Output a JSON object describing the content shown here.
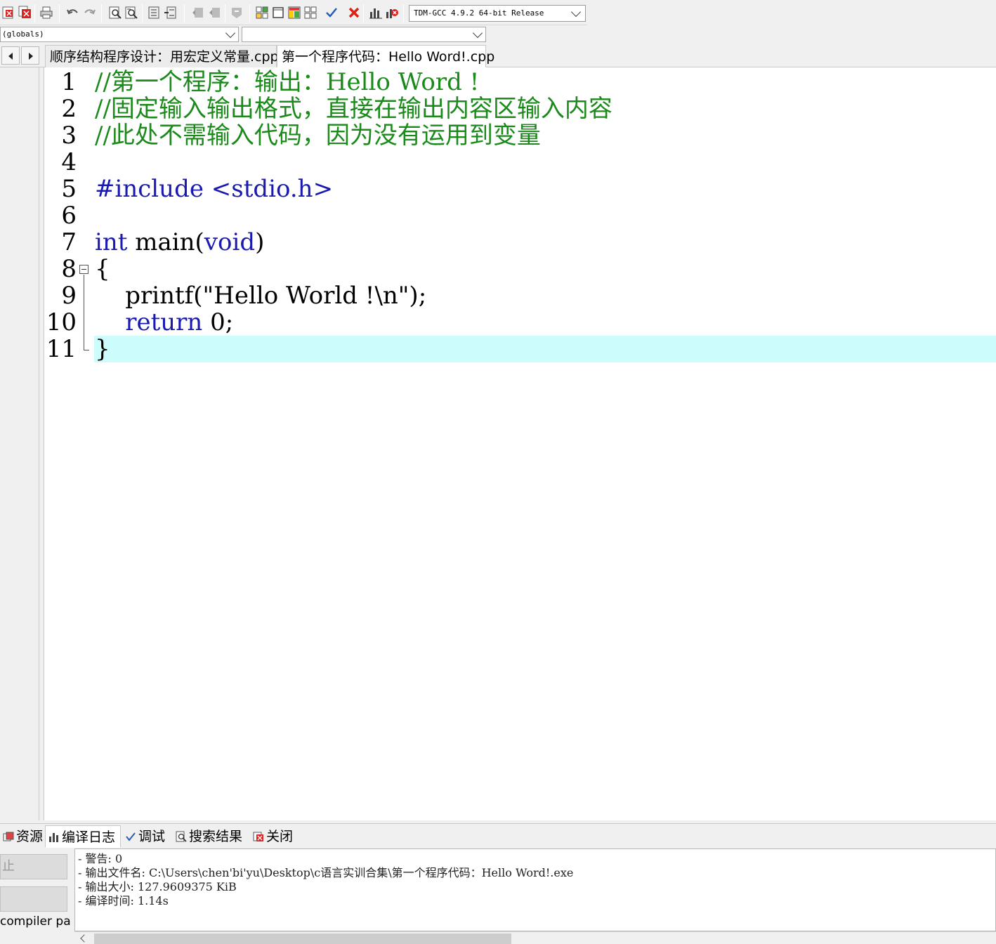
{
  "toolbar": {
    "buttons": [
      "close-file-icon",
      "close-all-icon",
      "print-icon",
      "undo-icon",
      "redo-icon",
      "find-icon",
      "replace-icon",
      "indent-icon",
      "unindent-icon",
      "goto-prev-icon",
      "goto-next-icon",
      "bookmark-icon",
      "new-project-icon",
      "view-window-icon",
      "compile-icon",
      "run-icon",
      "check-syntax-icon",
      "stop-icon",
      "chart-icon",
      "profile-icon"
    ],
    "compiler": "TDM-GCC 4.9.2 64-bit Release"
  },
  "classbar": {
    "scope": "(globals)",
    "member": ""
  },
  "tabs": [
    {
      "label": "顺序结构程序设计：用宏定义常量.cpp",
      "active": false
    },
    {
      "label": "第一个程序代码：Hello Word!.cpp",
      "active": true
    }
  ],
  "editor": {
    "lines": [
      {
        "num": "1",
        "tokens": [
          {
            "t": "//第一个程序：输出：Hello Word !",
            "c": "comment"
          }
        ]
      },
      {
        "num": "2",
        "tokens": [
          {
            "t": "//固定输入输出格式，直接在输出内容区输入内容",
            "c": "comment"
          }
        ]
      },
      {
        "num": "3",
        "tokens": [
          {
            "t": "//此处不需输入代码，因为没有运用到变量",
            "c": "comment"
          }
        ]
      },
      {
        "num": "4",
        "tokens": []
      },
      {
        "num": "5",
        "tokens": [
          {
            "t": "#include <stdio.h>",
            "c": "pre"
          }
        ]
      },
      {
        "num": "6",
        "tokens": []
      },
      {
        "num": "7",
        "tokens": [
          {
            "t": "int",
            "c": "kw"
          },
          {
            "t": " main(",
            "c": "plain"
          },
          {
            "t": "void",
            "c": "kw"
          },
          {
            "t": ")",
            "c": "plain"
          }
        ]
      },
      {
        "num": "8",
        "tokens": [
          {
            "t": "{",
            "c": "plain"
          }
        ]
      },
      {
        "num": "9",
        "tokens": [
          {
            "t": "    printf(\"Hello World !\\n\");",
            "c": "plain"
          }
        ]
      },
      {
        "num": "10",
        "tokens": [
          {
            "t": "    ",
            "c": "plain"
          },
          {
            "t": "return",
            "c": "kw"
          },
          {
            "t": " 0;",
            "c": "plain"
          }
        ]
      },
      {
        "num": "11",
        "tokens": [
          {
            "t": "}",
            "c": "plain"
          }
        ]
      }
    ],
    "current_line": 11,
    "colors": {
      "comment": "#1a8a1a",
      "keyword": "#1a1ab0",
      "current_line_bg": "#ccfcfc"
    }
  },
  "bottom": {
    "tabs": [
      {
        "label": "资源",
        "icon": "resource-icon"
      },
      {
        "label": "编译日志",
        "icon": "compile-log-icon",
        "active": true
      },
      {
        "label": "调试",
        "icon": "debug-icon"
      },
      {
        "label": "搜索结果",
        "icon": "search-results-icon"
      },
      {
        "label": "关闭",
        "icon": "close-panel-icon"
      }
    ],
    "stop_button": "止",
    "compiler_path_label": "compiler pat",
    "log_lines": [
      "- 警告: 0",
      "- 输出文件名: C:\\Users\\chen'bi'yu\\Desktop\\c语言实训合集\\第一个程序代码：Hello Word!.exe",
      "- 输出大小: 127.9609375 KiB",
      "- 编译时间: 1.14s"
    ]
  }
}
